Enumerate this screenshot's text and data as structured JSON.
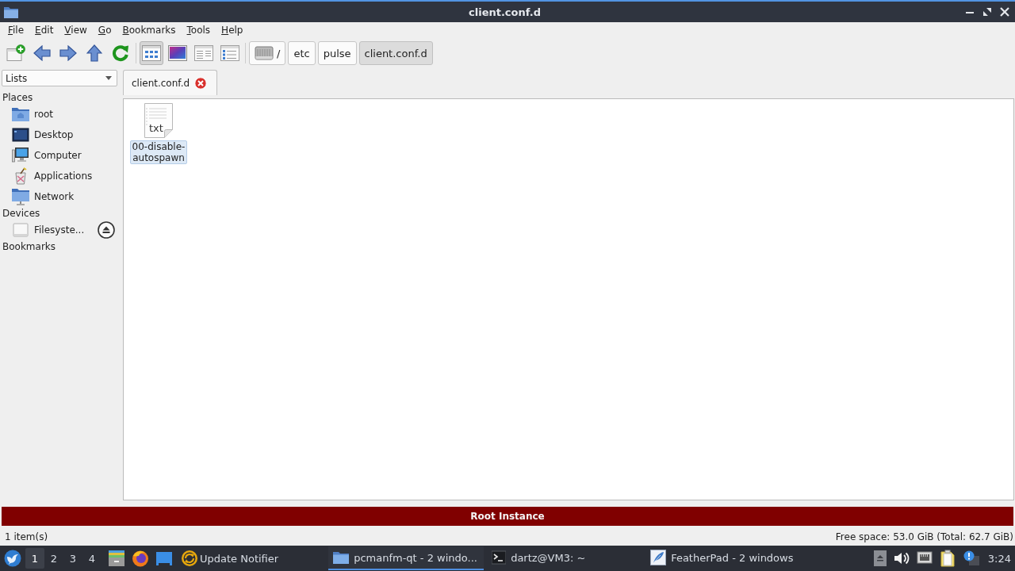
{
  "window": {
    "title": "client.conf.d"
  },
  "menu": [
    "File",
    "Edit",
    "View",
    "Go",
    "Bookmarks",
    "Tools",
    "Help"
  ],
  "view_modes": [
    {
      "kind": "icon",
      "selected": true
    },
    {
      "kind": "thumbnail",
      "selected": false
    },
    {
      "kind": "compact",
      "selected": false
    },
    {
      "kind": "detailed",
      "selected": false
    }
  ],
  "path_bar": [
    {
      "kind": "root",
      "label": "/",
      "selected": false
    },
    {
      "kind": "dir",
      "label": "etc",
      "selected": false
    },
    {
      "kind": "dir",
      "label": "pulse",
      "selected": false
    },
    {
      "kind": "dir",
      "label": "client.conf.d",
      "selected": true
    }
  ],
  "side_pane": {
    "selector": "Lists",
    "sections": [
      {
        "title": "Places",
        "items": [
          {
            "kind": "home",
            "label": "root"
          },
          {
            "kind": "desktop",
            "label": "Desktop"
          },
          {
            "kind": "computer",
            "label": "Computer"
          },
          {
            "kind": "applications",
            "label": "Applications"
          },
          {
            "kind": "network",
            "label": "Network"
          }
        ]
      },
      {
        "title": "Devices",
        "items": [
          {
            "kind": "drive",
            "label": "Filesyste...",
            "ejectable": true
          }
        ]
      },
      {
        "title": "Bookmarks"
      }
    ]
  },
  "tabs": [
    {
      "label": "client.conf.d",
      "selected": true
    }
  ],
  "files": [
    {
      "name": "00-disable-autospawn",
      "icon_text": "txt",
      "selected": true
    }
  ],
  "banner": "Root Instance",
  "status_bar": {
    "items": "1 item(s)",
    "free_space": "Free space: 53.0 GiB (Total: 62.7 GiB)"
  },
  "taskbar": {
    "desktops": [
      {
        "label": "1",
        "selected": true
      },
      {
        "label": "2",
        "selected": false
      },
      {
        "label": "3",
        "selected": false
      },
      {
        "label": "4",
        "selected": false
      }
    ],
    "update_notifier": "Update Notifier",
    "tasks": [
      {
        "kind": "file-manager",
        "label": "pcmanfm-qt - 2 windo...",
        "selected": true
      },
      {
        "kind": "terminal",
        "label": "dartz@VM3: ~",
        "selected": false
      },
      {
        "kind": "text-editor",
        "label": "FeatherPad - 2 windows",
        "selected": false
      }
    ],
    "clock": "3:24"
  }
}
